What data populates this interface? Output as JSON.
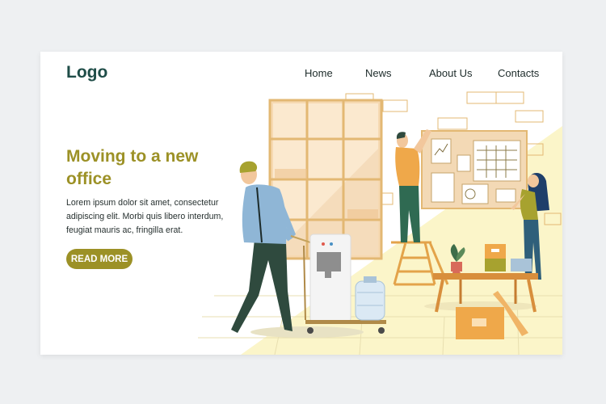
{
  "header": {
    "logo_text": "Logo",
    "nav": [
      {
        "label": "Home"
      },
      {
        "label": "News"
      },
      {
        "label": "About Us"
      },
      {
        "label": "Contacts"
      }
    ]
  },
  "hero": {
    "title": "Moving to a new office",
    "body": "Lorem ipsum dolor sit amet, consectetur adipiscing elit. Morbi quis libero interdum, feugiat mauris ac, fringilla erat.",
    "cta_label": "READ MORE"
  },
  "colors": {
    "page_background": "#eef0f2",
    "card_background": "#ffffff",
    "logo": "#1f4d48",
    "accent_olive": "#9c9126",
    "floor_yellow": "#fbf5c9",
    "wall_brick_outline": "#e3b873",
    "board": "#f3d9b5"
  },
  "illustration": {
    "scene": "office-moving",
    "icons": [
      "window-icon",
      "man-pushing-cart-icon",
      "water-cooler-icon",
      "water-bottle-icon",
      "ladder-icon",
      "man-on-ladder-icon",
      "woman-pinning-icon",
      "planner-board-icon",
      "table-icon",
      "plant-icon",
      "storage-box-icon",
      "cardboard-box-icon"
    ]
  }
}
